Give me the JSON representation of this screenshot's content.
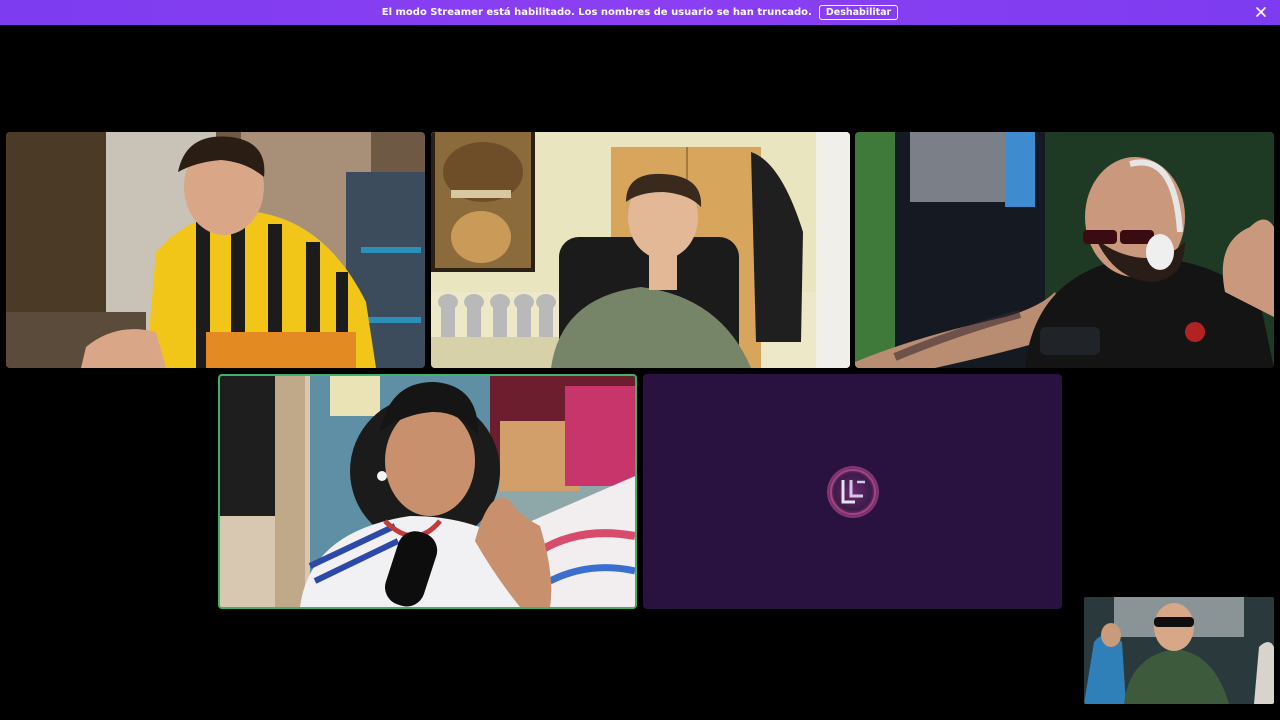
{
  "notice": {
    "message": "El modo Streamer está habilitado. Los nombres de usuario se han truncado.",
    "button_label": "Deshabilitar",
    "background_color": "#8c3ff2"
  },
  "participants": [
    {
      "id": "tile-1",
      "video": true,
      "speaking": false
    },
    {
      "id": "tile-2",
      "video": true,
      "speaking": false
    },
    {
      "id": "tile-3",
      "video": true,
      "speaking": false
    },
    {
      "id": "tile-4",
      "video": true,
      "speaking": true,
      "speaking_color": "#3fb266"
    },
    {
      "id": "tile-5",
      "video": false,
      "avatar_icon": "user-avatar-icon",
      "background_color": "#2a1240"
    }
  ],
  "pip": {
    "video": true
  }
}
